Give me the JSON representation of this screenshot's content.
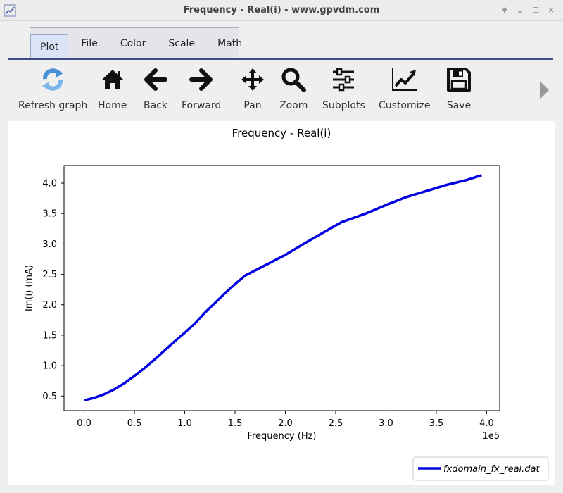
{
  "window": {
    "title": "Frequency - Real(i) - www.gpvdm.com"
  },
  "tabs": [
    {
      "label": "Plot"
    },
    {
      "label": "File"
    },
    {
      "label": "Color"
    },
    {
      "label": "Scale"
    },
    {
      "label": "Math"
    }
  ],
  "toolbar": {
    "refresh": "Refresh graph",
    "home": "Home",
    "back": "Back",
    "forward": "Forward",
    "pan": "Pan",
    "zoom": "Zoom",
    "subplots": "Subplots",
    "customize": "Customize",
    "save": "Save"
  },
  "colors": {
    "line": "#0000e0",
    "accent": "#3e4c8a"
  },
  "chart_data": {
    "type": "line",
    "title": "Frequency - Real(i)",
    "xlabel": "Frequency (Hz)",
    "ylabel": "Im(i) (mA)",
    "x_multiplier_label": "1e5",
    "xlim": [
      -0.2,
      4.13
    ],
    "ylim": [
      0.26,
      4.29
    ],
    "x_ticks": [
      0.0,
      0.5,
      1.0,
      1.5,
      2.0,
      2.5,
      3.0,
      3.5,
      4.0
    ],
    "x_tick_labels": [
      "0.0",
      "0.5",
      "1.0",
      "1.5",
      "2.0",
      "2.5",
      "3.0",
      "3.5",
      "4.0"
    ],
    "y_ticks": [
      0.5,
      1.0,
      1.5,
      2.0,
      2.5,
      3.0,
      3.5,
      4.0
    ],
    "y_tick_labels": [
      "0.5",
      "1.0",
      "1.5",
      "2.0",
      "2.5",
      "3.0",
      "3.5",
      "4.0"
    ],
    "grid": false,
    "legend_position": "bottom-right",
    "series": [
      {
        "name": "fxdomain_fx_real.dat",
        "x": [
          0.0,
          0.1,
          0.2,
          0.3,
          0.4,
          0.5,
          0.6,
          0.7,
          0.8,
          0.9,
          1.0,
          1.1,
          1.2,
          1.3,
          1.4,
          1.5,
          1.6,
          1.8,
          2.0,
          2.2,
          2.4,
          2.56,
          2.8,
          3.0,
          3.2,
          3.4,
          3.6,
          3.8,
          3.95
        ],
        "y": [
          0.43,
          0.47,
          0.53,
          0.61,
          0.71,
          0.83,
          0.96,
          1.1,
          1.25,
          1.4,
          1.54,
          1.69,
          1.87,
          2.03,
          2.19,
          2.34,
          2.48,
          2.65,
          2.82,
          3.02,
          3.21,
          3.36,
          3.5,
          3.64,
          3.77,
          3.87,
          3.97,
          4.05,
          4.13
        ]
      }
    ]
  }
}
